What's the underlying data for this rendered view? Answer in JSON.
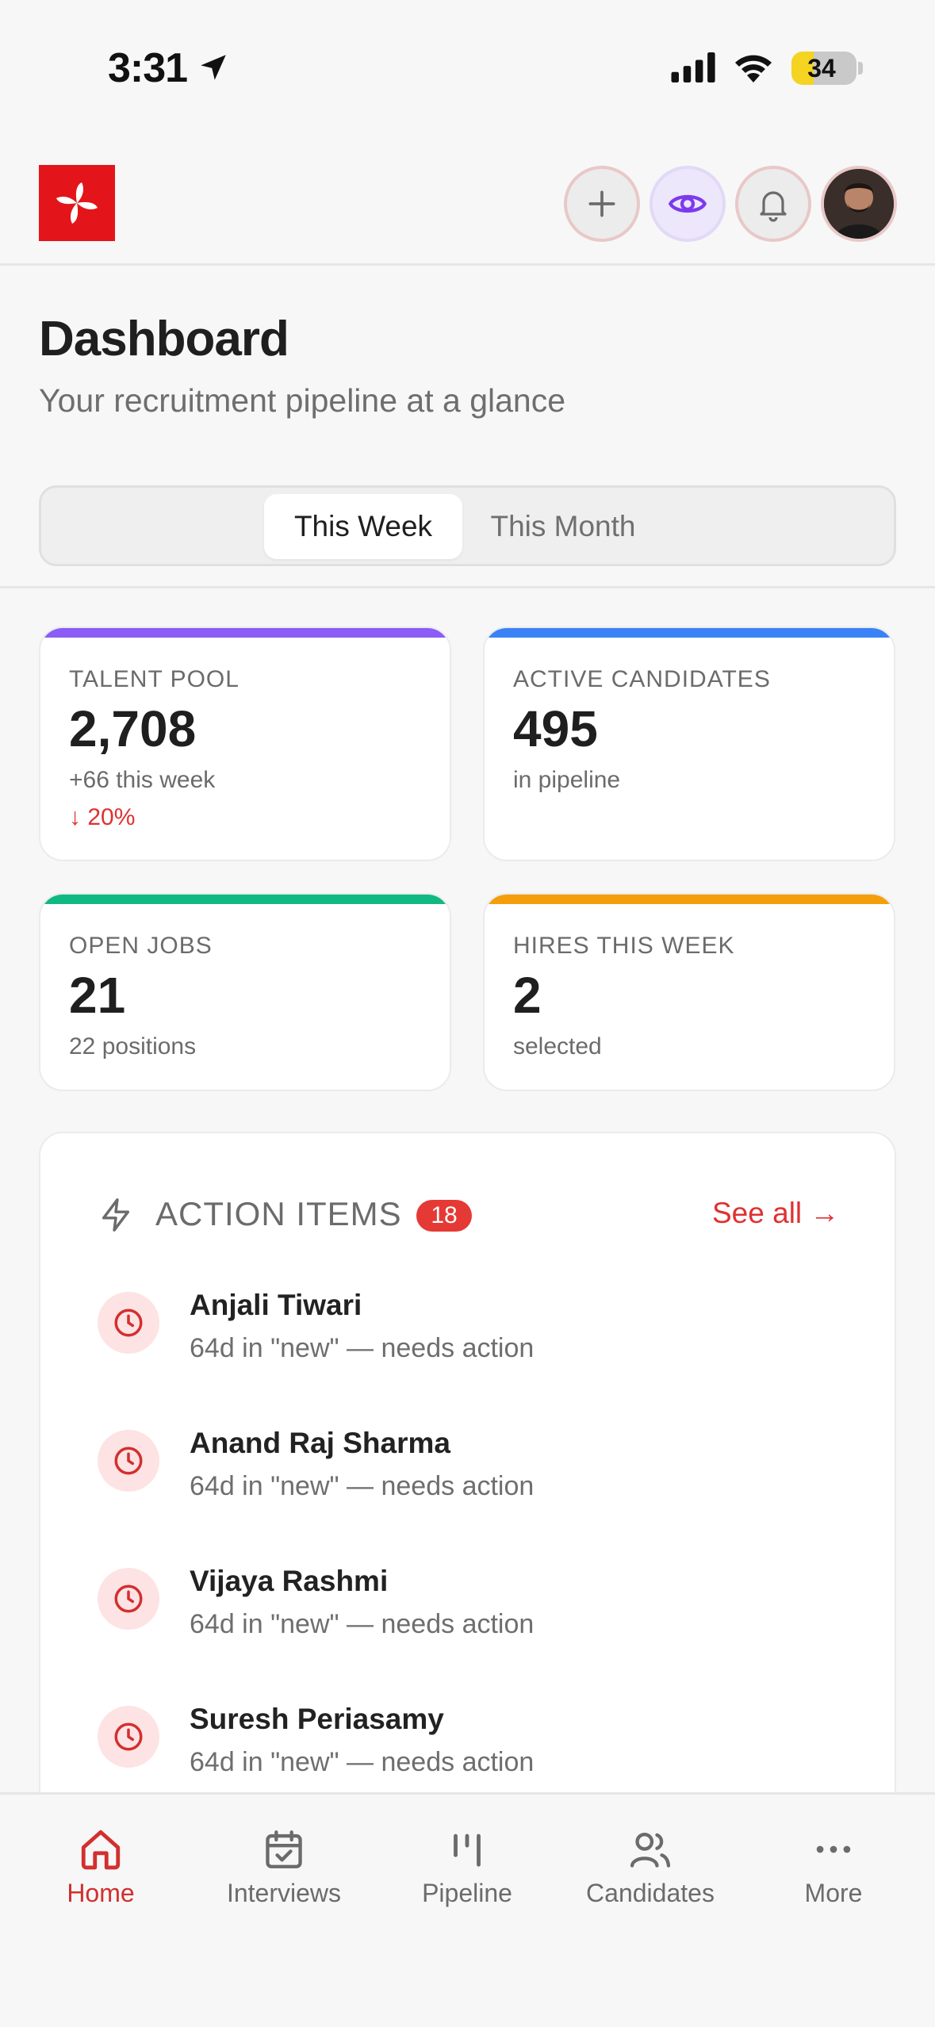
{
  "status_bar": {
    "time": "3:31",
    "battery_level": 34,
    "battery_text": "34",
    "icons": [
      "location-arrow-icon",
      "cellular-signal-icon",
      "wifi-icon",
      "battery-icon"
    ]
  },
  "header": {
    "logo_icon": "pinwheel-logo-icon",
    "buttons": [
      "plus-icon",
      "eye-icon",
      "bell-icon"
    ],
    "avatar": "user-avatar"
  },
  "page": {
    "title": "Dashboard",
    "subtitle": "Your recruitment pipeline at a glance"
  },
  "period_toggle": {
    "options": [
      "This Week",
      "This Month"
    ],
    "selected": "This Week"
  },
  "stats": [
    {
      "label": "TALENT POOL",
      "value": "2,708",
      "sub": "+66 this week",
      "trend": "↓ 20%",
      "color": "#8b5cf6"
    },
    {
      "label": "ACTIVE CANDIDATES",
      "value": "495",
      "sub": "in pipeline",
      "color": "#3b82f6"
    },
    {
      "label": "OPEN JOBS",
      "value": "21",
      "sub": "22 positions",
      "color": "#10b981"
    },
    {
      "label": "HIRES THIS WEEK",
      "value": "2",
      "sub": "selected",
      "color": "#f59e0b"
    }
  ],
  "action_items": {
    "title": "ACTION ITEMS",
    "count": "18",
    "see_all": "See all →",
    "items": [
      {
        "name": "Anjali Tiwari",
        "detail": "64d in \"new\" — needs action"
      },
      {
        "name": "Anand Raj Sharma",
        "detail": "64d in \"new\" — needs action"
      },
      {
        "name": "Vijaya Rashmi",
        "detail": "64d in \"new\" — needs action"
      },
      {
        "name": "Suresh Periasamy",
        "detail": "64d in \"new\" — needs action"
      }
    ]
  },
  "tabs": [
    {
      "label": "Home",
      "icon": "home-icon",
      "active": true
    },
    {
      "label": "Interviews",
      "icon": "calendar-icon",
      "active": false
    },
    {
      "label": "Pipeline",
      "icon": "pipeline-icon",
      "active": false
    },
    {
      "label": "Candidates",
      "icon": "users-icon",
      "active": false
    },
    {
      "label": "More",
      "icon": "more-icon",
      "active": false
    }
  ],
  "colors": {
    "accent": "#e03131",
    "logo_red": "#e3151b",
    "eye_purple": "#7c3aed"
  }
}
